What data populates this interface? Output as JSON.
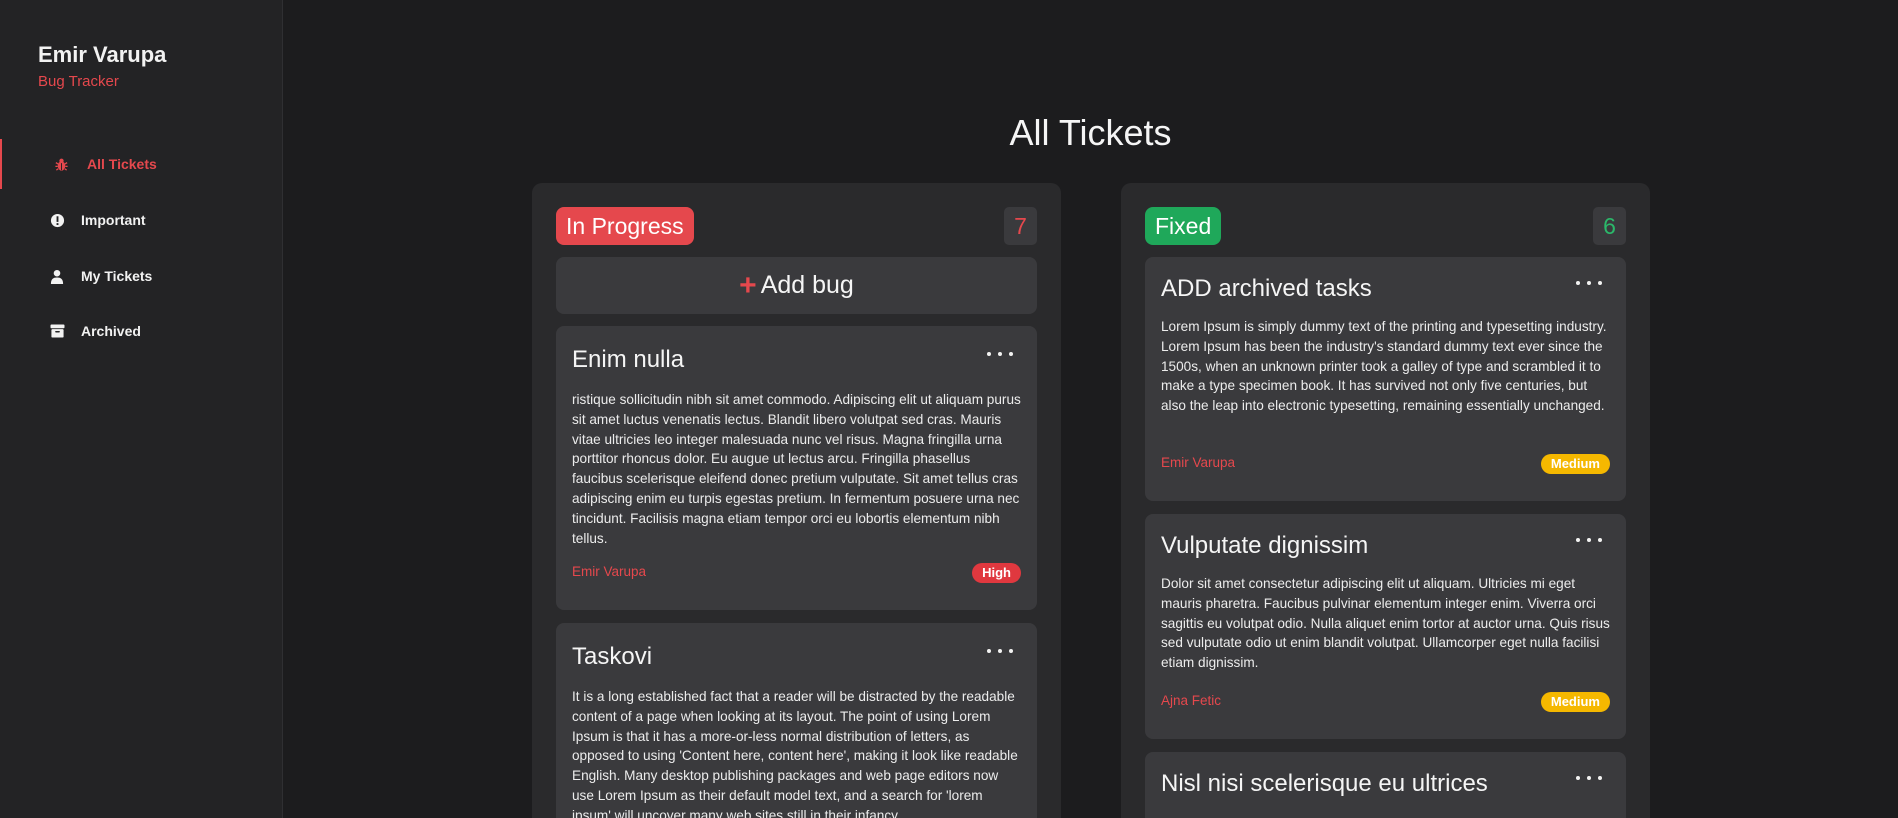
{
  "sidebar": {
    "brand_name": "Emir Varupa",
    "brand_sub": "Bug Tracker",
    "nav": [
      {
        "label": "All Tickets",
        "icon": "bug-icon",
        "active": true
      },
      {
        "label": "Important",
        "icon": "exclamation-circle-icon",
        "active": false
      },
      {
        "label": "My Tickets",
        "icon": "user-icon",
        "active": false
      },
      {
        "label": "Archived",
        "icon": "archive-icon",
        "active": false
      }
    ]
  },
  "main": {
    "title": "All Tickets",
    "add_bug_label": "Add bug",
    "columns": [
      {
        "status": "In Progress",
        "count": "7",
        "color": "#e5484d",
        "cards": [
          {
            "title": "Enim nulla",
            "description": "ristique sollicitudin nibh sit amet commodo. Adipiscing elit ut aliquam purus sit amet luctus venenatis lectus. Blandit libero volutpat sed cras. Mauris vitae ultricies leo integer malesuada nunc vel risus. Magna fringilla urna porttitor rhoncus dolor. Eu augue ut lectus arcu. Fringilla phasellus faucibus scelerisque eleifend donec pretium vulputate. Sit amet tellus cras adipiscing enim eu turpis egestas pretium. In fermentum posuere urna nec tincidunt. Facilisis magna etiam tempor orci eu lobortis elementum nibh tellus.",
            "author": "Emir Varupa",
            "priority": "High"
          },
          {
            "title": "Taskovi",
            "description": "It is a long established fact that a reader will be distracted by the readable content of a page when looking at its layout. The point of using Lorem Ipsum is that it has a more-or-less normal distribution of letters, as opposed to using 'Content here, content here', making it look like readable English. Many desktop publishing packages and web page editors now use Lorem Ipsum as their default model text, and a search for 'lorem ipsum' will uncover many web sites still in their infancy.",
            "author": "",
            "priority": ""
          }
        ]
      },
      {
        "status": "Fixed",
        "count": "6",
        "color": "#1fa85a",
        "cards": [
          {
            "title": "ADD archived tasks",
            "description": "Lorem Ipsum is simply dummy text of the printing and typesetting industry. Lorem Ipsum has been the industry's standard dummy text ever since the 1500s, when an unknown printer took a galley of type and scrambled it to make a type specimen book. It has survived not only five centuries, but also the leap into electronic typesetting, remaining essentially unchanged.",
            "author": "Emir Varupa",
            "priority": "Medium"
          },
          {
            "title": "Vulputate dignissim",
            "description": "Dolor sit amet consectetur adipiscing elit ut aliquam. Ultricies mi eget mauris pharetra. Faucibus pulvinar elementum integer enim. Viverra orci sagittis eu volutpat odio. Nulla aliquet enim tortor at auctor urna. Quis risus sed vulputate odio ut enim blandit volutpat. Ullamcorper eget nulla facilisi etiam dignissim.",
            "author": "Ajna Fetic",
            "priority": "Medium"
          },
          {
            "title": "Nisl nisi scelerisque eu ultrices",
            "description": "",
            "author": "",
            "priority": ""
          }
        ]
      }
    ]
  }
}
